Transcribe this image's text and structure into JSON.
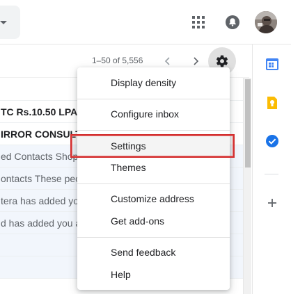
{
  "header": {
    "apps_icon": "apps-grid-icon",
    "notifications_icon": "notifications-icon",
    "avatar_icon": "account-avatar"
  },
  "toolbar": {
    "pager_text": "1–50 of 5,556",
    "prev_icon": "chevron-left-icon",
    "next_icon": "chevron-right-icon",
    "settings_icon": "gear-icon"
  },
  "mail_list": {
    "rows": [
      {
        "text": "",
        "state": "blank"
      },
      {
        "text": "TC Rs.10.50 LPA -",
        "state": "unread"
      },
      {
        "text": "IRROR CONSULTA",
        "state": "unread"
      },
      {
        "text": "ed Contacts Shop",
        "state": "read"
      },
      {
        "text": "ontacts These peo",
        "state": "read"
      },
      {
        "text": "tera has added yo",
        "state": "read"
      },
      {
        "text": "d has added you a",
        "state": "read"
      },
      {
        "text": "",
        "state": "read"
      },
      {
        "text": "",
        "state": "read"
      }
    ]
  },
  "side_panel": {
    "calendar_icon": "calendar-icon",
    "keep_icon": "keep-icon",
    "tasks_icon": "tasks-icon",
    "add_icon": "plus-icon"
  },
  "settings_menu": {
    "display_density": "Display density",
    "configure_inbox": "Configure inbox",
    "settings": "Settings",
    "themes": "Themes",
    "customize_address": "Customize address",
    "get_addons": "Get add-ons",
    "send_feedback": "Send feedback",
    "help": "Help"
  },
  "colors": {
    "highlight_border": "#d32f2f",
    "calendar_blue": "#4285f4",
    "keep_yellow": "#fbbc04",
    "tasks_blue": "#1a73e8"
  }
}
